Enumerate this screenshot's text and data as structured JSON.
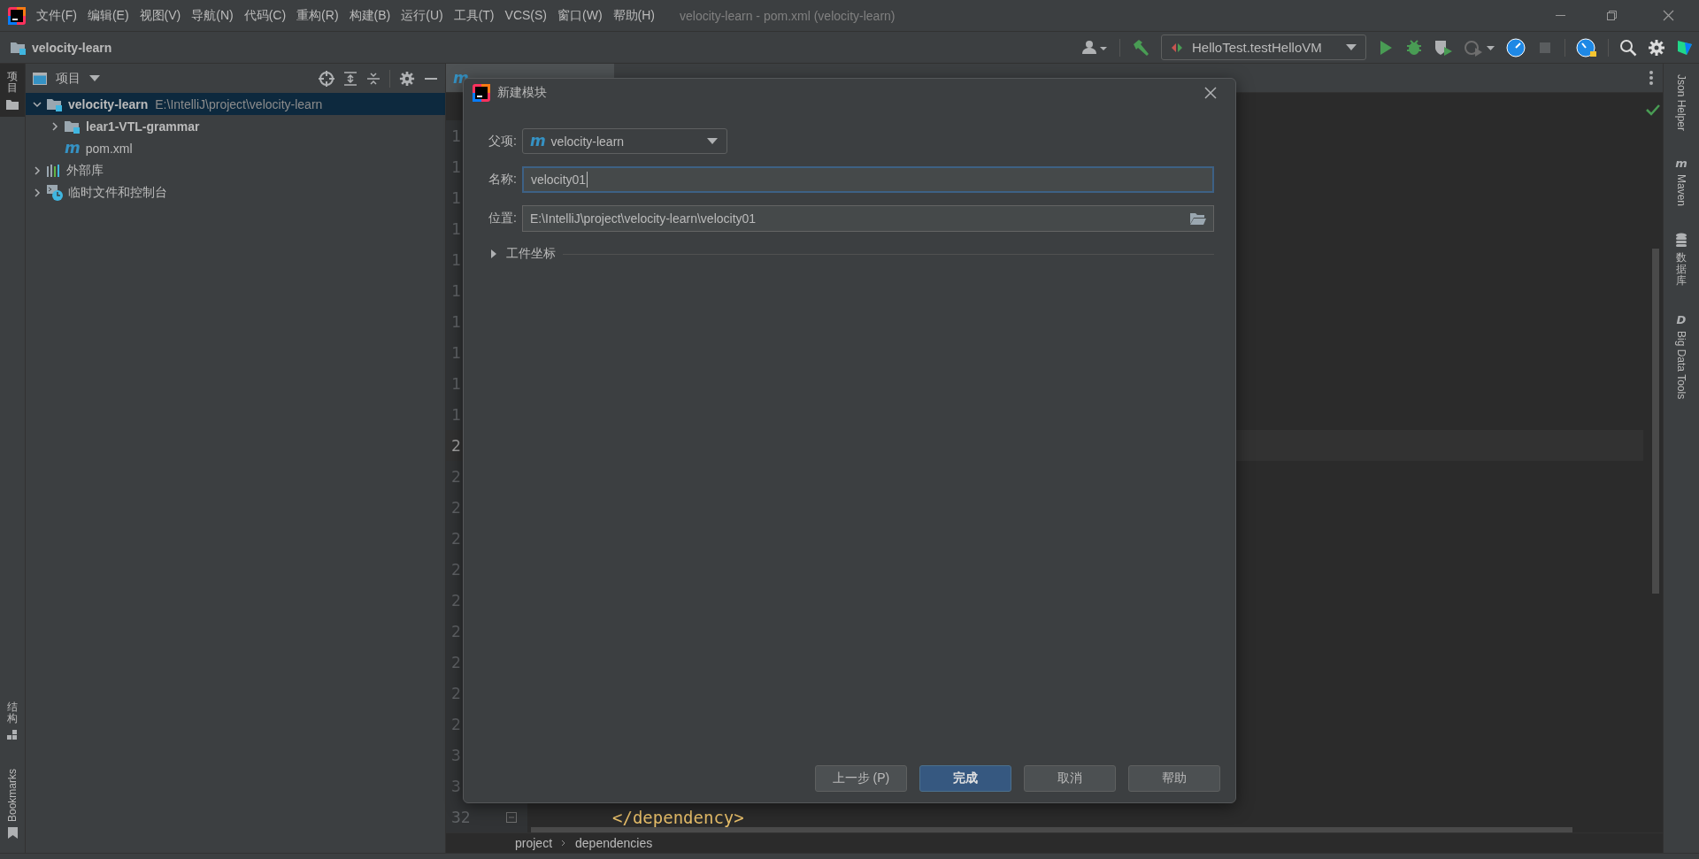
{
  "window": {
    "title": "velocity-learn - pom.xml (velocity-learn)",
    "menu": [
      "文件(F)",
      "编辑(E)",
      "视图(V)",
      "导航(N)",
      "代码(C)",
      "重构(R)",
      "构建(B)",
      "运行(U)",
      "工具(T)",
      "VCS(S)",
      "窗口(W)",
      "帮助(H)"
    ]
  },
  "navbar": {
    "project": "velocity-learn",
    "run_configuration": "HelloTest.testHelloVM"
  },
  "left_stripe": {
    "top": [
      {
        "label": "项目",
        "kind": "cjk",
        "selected": true
      }
    ],
    "bottom": [
      {
        "label": "结构",
        "kind": "cjk",
        "selected": false
      },
      {
        "label": "Bookmarks",
        "kind": "latin",
        "selected": false
      }
    ]
  },
  "project_panel": {
    "title": "项目",
    "tree": [
      {
        "label": "velocity-learn",
        "path": "E:\\IntelliJ\\project\\velocity-learn",
        "kind": "module",
        "expanded": true,
        "selected": true,
        "children": [
          {
            "label": "lear1-VTL-grammar",
            "kind": "module",
            "expanded": false,
            "selected": false
          },
          {
            "label": "pom.xml",
            "kind": "maven",
            "icon_text": "m",
            "selected": false
          }
        ]
      },
      {
        "label": "外部库",
        "kind": "libraries",
        "expanded": false,
        "selected": false
      },
      {
        "label": "临时文件和控制台",
        "kind": "scratches",
        "expanded": false,
        "selected": false
      }
    ]
  },
  "editor": {
    "tab": {
      "icon_text": "m"
    },
    "lines": [
      {
        "number": "1",
        "selected": false
      },
      {
        "number": "1",
        "selected": false
      },
      {
        "number": "1",
        "selected": false
      },
      {
        "number": "1",
        "selected": false
      },
      {
        "number": "1",
        "selected": false
      },
      {
        "number": "1",
        "selected": false
      },
      {
        "number": "1",
        "selected": false
      },
      {
        "number": "1",
        "selected": false
      },
      {
        "number": "1",
        "selected": false
      },
      {
        "number": "1",
        "selected": false
      },
      {
        "number": "2",
        "selected": true
      },
      {
        "number": "2",
        "selected": false
      },
      {
        "number": "2",
        "selected": false
      },
      {
        "number": "2",
        "selected": false
      },
      {
        "number": "2",
        "selected": false
      },
      {
        "number": "2",
        "selected": false
      },
      {
        "number": "2",
        "selected": false
      },
      {
        "number": "2",
        "selected": false
      },
      {
        "number": "2",
        "selected": false
      },
      {
        "number": "2",
        "selected": false
      },
      {
        "number": "3",
        "selected": false
      },
      {
        "number": "3",
        "selected": false
      },
      {
        "number": "32",
        "selected": false,
        "code": "</dependency>"
      }
    ],
    "breadcrumbs": [
      "project",
      "dependencies"
    ]
  },
  "right_stripe": [
    {
      "label": "Json Helper",
      "kind": "latin"
    },
    {
      "label": "Maven",
      "kind": "latin",
      "icon_text": "m"
    },
    {
      "label": "数据库",
      "kind": "cjk"
    },
    {
      "label": "Big Data Tools",
      "kind": "latin",
      "icon_text": "D"
    }
  ],
  "dialog": {
    "title": "新建模块",
    "fields": [
      {
        "kind": "dropdown",
        "label": "父项:",
        "value": "velocity-learn",
        "icon_text": "m",
        "focused": false
      },
      {
        "kind": "text",
        "label": "名称:",
        "value": "velocity01",
        "focused": true
      },
      {
        "kind": "path",
        "label": "位置:",
        "value": "E:\\IntelliJ\\project\\velocity-learn\\velocity01",
        "focused": false
      }
    ],
    "section": {
      "label": "工件坐标",
      "expanded": false
    },
    "buttons": [
      {
        "label": "上一步 (P)",
        "primary": false
      },
      {
        "label": "完成",
        "primary": true
      },
      {
        "label": "取消",
        "primary": false
      },
      {
        "label": "帮助",
        "primary": false
      }
    ]
  }
}
